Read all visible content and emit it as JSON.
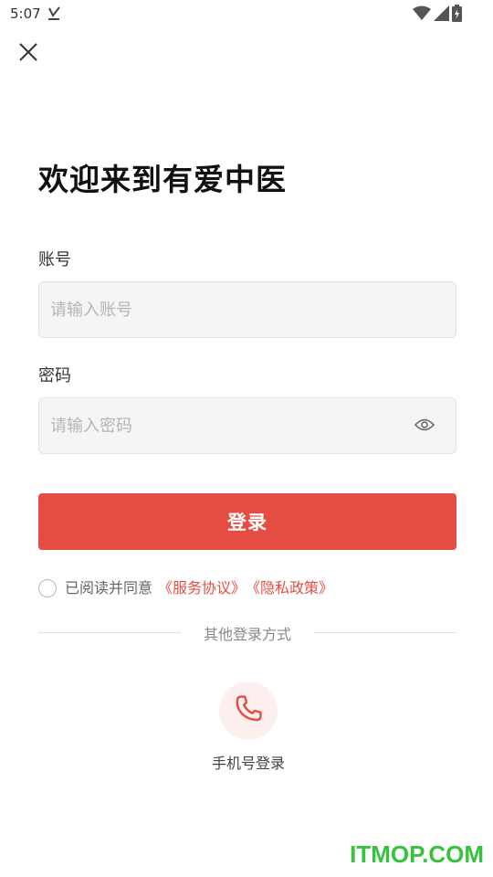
{
  "status_bar": {
    "time": "5:07"
  },
  "header": {
    "close_icon": "close-icon"
  },
  "title": "欢迎来到有爱中医",
  "form": {
    "account_label": "账号",
    "account_placeholder": "请输入账号",
    "account_value": "",
    "password_label": "密码",
    "password_placeholder": "请输入密码",
    "password_value": "",
    "eye_icon": "eye-icon"
  },
  "login_button_label": "登录",
  "agreement": {
    "checked": false,
    "prefix": "已阅读并同意",
    "terms_link": "《服务协议》",
    "privacy_link": "《隐私政策》"
  },
  "other_login": {
    "divider_text": "其他登录方式",
    "phone_label": "手机号登录",
    "phone_icon": "phone-icon"
  },
  "watermark": "ITMOP.COM",
  "colors": {
    "accent": "#e54d42",
    "accent_light": "#fdefee",
    "watermark": "#35c23d"
  }
}
